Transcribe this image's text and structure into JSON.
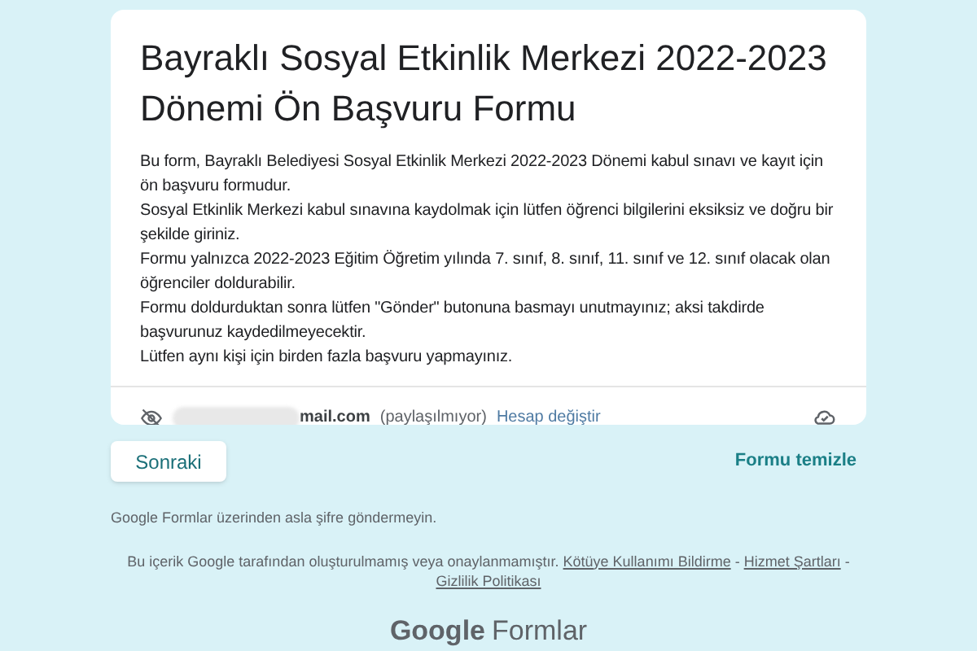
{
  "form": {
    "title": "Bayraklı Sosyal Etkinlik Merkezi 2022-2023 Dönemi Ön Başvuru Formu",
    "description": [
      "Bu form, Bayraklı Belediyesi Sosyal Etkinlik Merkezi 2022-2023 Dönemi kabul sınavı ve kayıt için ön başvuru formudur.",
      "Sosyal Etkinlik Merkezi kabul sınavına kaydolmak için lütfen öğrenci bilgilerini eksiksiz ve doğru bir şekilde giriniz.",
      "Formu yalnızca 2022-2023 Eğitim Öğretim yılında 7. sınıf, 8. sınıf, 11. sınıf ve 12. sınıf olacak olan öğrenciler doldurabilir.",
      "Formu doldurduktan sonra lütfen \"Gönder\" butonuna basmayı unutmayınız; aksi takdirde başvurunuz kaydedilmeyecektir.",
      "Lütfen aynı kişi için birden fazla başvuru yapmayınız."
    ],
    "account": {
      "email": "mail.com",
      "sharing": "(paylaşılmıyor)",
      "switch_link": "Hesap değiştir"
    }
  },
  "next_button": "Sonraki",
  "clear_link": "Formu temizle",
  "password_warning": "Google Formlar üzerinden asla şifre göndermeyin.",
  "disclaimer": {
    "text": "Bu içerik Google tarafından oluşturulmamış veya onaylanmamıştır.",
    "links": [
      "Kötüye Kullanımı Bildirme",
      "Hizmet Şartları",
      "Gizlilik Politikası"
    ],
    "separator": "-"
  },
  "logo": {
    "brand": "Google",
    "product": "Formlar"
  }
}
